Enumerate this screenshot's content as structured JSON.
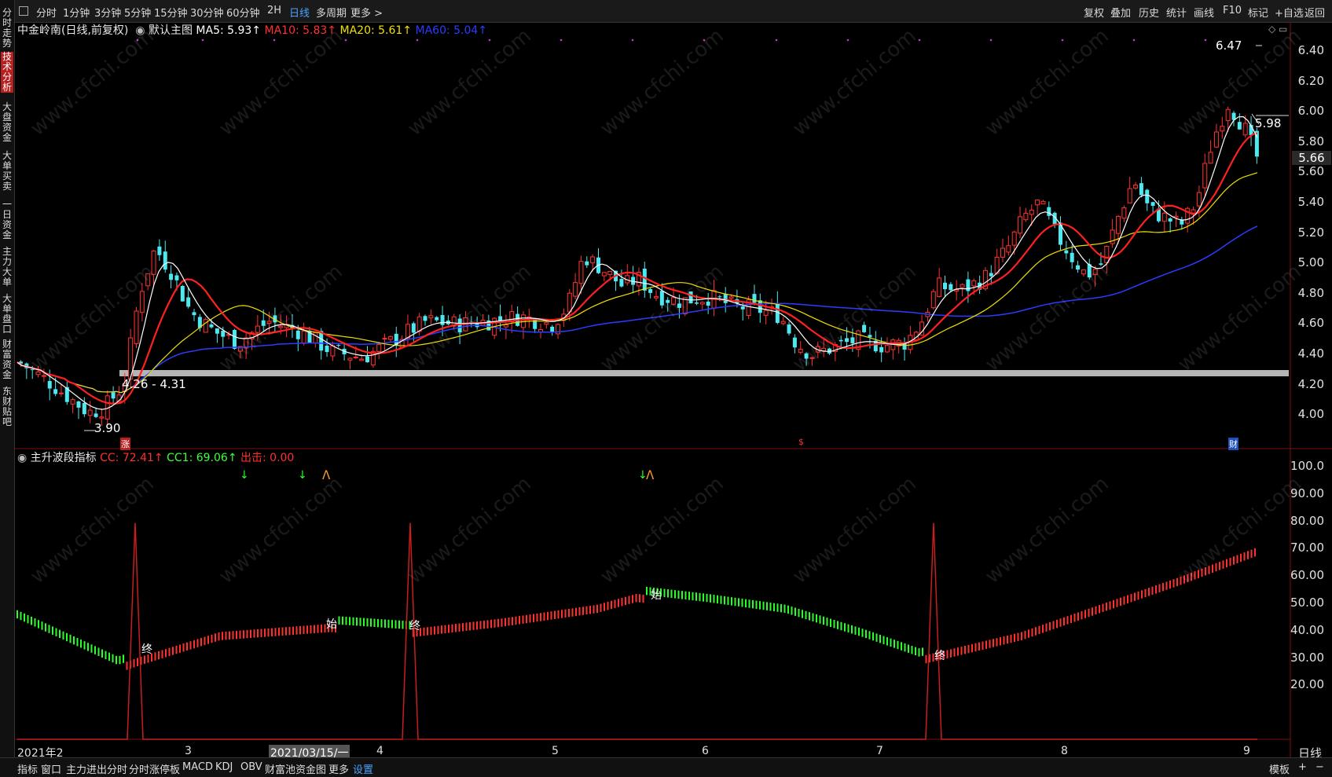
{
  "topbar": {
    "periods": [
      "分时",
      "1分钟",
      "3分钟",
      "5分钟",
      "15分钟",
      "30分钟",
      "60分钟",
      "2H",
      "日线",
      "多周期",
      "更多 >"
    ],
    "active_period": "日线",
    "tools": [
      "复权",
      "叠加",
      "历史",
      "统计",
      "画线",
      "F10",
      "标记",
      "+自选",
      "返回"
    ]
  },
  "sidebar": {
    "items": [
      "分时走势",
      "技术分析",
      "大盘资金",
      "大单买卖",
      "一日资金",
      "主力大单",
      "大单盘口",
      "财富资金",
      "东财贴吧"
    ],
    "active": "技术分析"
  },
  "main": {
    "title": "中金岭南(日线,前复权)",
    "template": "默认主图",
    "ma": [
      {
        "label": "MA5: 5.93↑",
        "color": "#ffffff"
      },
      {
        "label": "MA10: 5.83↑",
        "color": "#ff3030"
      },
      {
        "label": "MA20: 5.61↑",
        "color": "#f0e000"
      },
      {
        "label": "MA60: 5.04↑",
        "color": "#2c3cff"
      }
    ],
    "y_ticks": [
      "6.40",
      "6.20",
      "6.00",
      "5.80",
      "5.60",
      "5.40",
      "5.20",
      "5.00",
      "4.80",
      "4.60",
      "4.40",
      "4.20",
      "4.00"
    ],
    "current_price": "5.66",
    "high_label": "6.47",
    "last_label": "5.98",
    "low_label": "3.90",
    "band_label": "4.26 - 4.31",
    "markers": [
      "涨",
      "$",
      "财"
    ]
  },
  "sub": {
    "title": "主升波段指标",
    "legend": [
      {
        "label": "CC: 72.41↑",
        "color": "#ff3030"
      },
      {
        "label": "CC1: 69.06↑",
        "color": "#3cff3c"
      },
      {
        "label": "出击: 0.00",
        "color": "#ff3030"
      }
    ],
    "y_ticks": [
      "100.0",
      "90.00",
      "80.00",
      "70.00",
      "60.00",
      "50.00",
      "40.00",
      "30.00",
      "20.00"
    ],
    "annotations": [
      "终",
      "终",
      "始",
      "终",
      "始",
      "终"
    ]
  },
  "xaxis": {
    "labels": [
      "2021年2",
      "3",
      "2021/03/15/一",
      "4",
      "5",
      "6",
      "7",
      "8",
      "9"
    ],
    "period_label": "日线"
  },
  "bottombar": {
    "items": [
      "指标",
      "窗口",
      "主力进出分时",
      "分时涨停板",
      "MACD",
      "KDJ",
      "OBV",
      "财富池资金图",
      "更多",
      "设置"
    ],
    "active": "设置",
    "right": [
      "模板",
      "+",
      "−"
    ]
  },
  "watermark": "www.cfchi.com",
  "colors": {
    "up": "#ff3030",
    "down": "#4de8f0",
    "ma5": "#ffffff",
    "ma10": "#ff3030",
    "ma20": "#f0e000",
    "ma60": "#2c3cff",
    "signal": "#c81e1e",
    "green": "#2bff2b"
  }
}
